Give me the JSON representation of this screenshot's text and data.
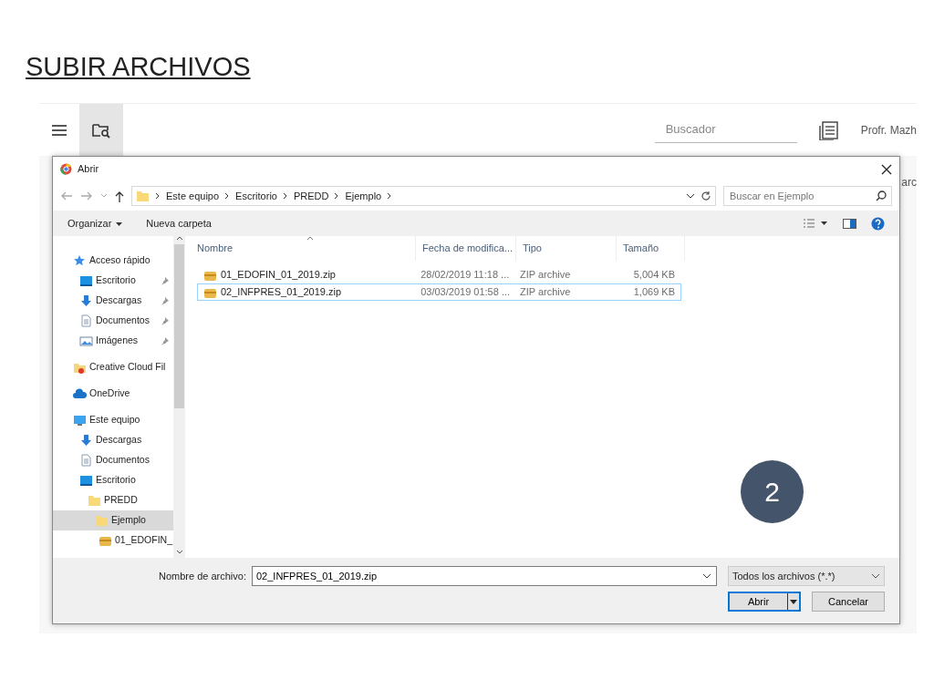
{
  "slide_title": "SUBIR ARCHIVOS",
  "app": {
    "search": {
      "placeholder": "Buscador"
    },
    "user": "Profr. Mazh",
    "edge_text": "arc"
  },
  "dialog": {
    "title": "Abrir",
    "breadcrumb": [
      "Este equipo",
      "Escritorio",
      "PREDD",
      "Ejemplo"
    ],
    "search": {
      "placeholder": "Buscar en Ejemplo"
    },
    "toolbar": [
      {
        "label": "Organizar",
        "dropdown": true
      },
      {
        "label": "Nueva carpeta"
      }
    ],
    "nav": [
      {
        "label": "Acceso rápido",
        "kind": "star",
        "selected": false,
        "children": [
          {
            "label": "Escritorio",
            "kind": "desktop",
            "pinned": true,
            "selected": false
          },
          {
            "label": "Descargas",
            "kind": "download",
            "pinned": true,
            "selected": false
          },
          {
            "label": "Documentos",
            "kind": "document",
            "pinned": true,
            "selected": false
          },
          {
            "label": "Imágenes",
            "kind": "image",
            "pinned": true,
            "selected": false
          }
        ]
      },
      {
        "label": "Creative Cloud Fil",
        "kind": "ccfolder",
        "selected": false
      },
      {
        "label": "OneDrive",
        "kind": "cloud",
        "selected": false
      },
      {
        "label": "Este equipo",
        "kind": "computer",
        "selected": false,
        "children": [
          {
            "label": "Descargas",
            "kind": "download",
            "selected": false
          },
          {
            "label": "Documentos",
            "kind": "document",
            "selected": false
          },
          {
            "label": "Escritorio",
            "kind": "desktop",
            "selected": false,
            "children": [
              {
                "label": "PREDD",
                "kind": "folder",
                "selected": false,
                "children": [
                  {
                    "label": "Ejemplo",
                    "kind": "folder",
                    "selected": true,
                    "children": [
                      {
                        "label": "01_EDOFIN_",
                        "kind": "zip",
                        "selected": false
                      }
                    ]
                  }
                ]
              }
            ]
          }
        ]
      }
    ],
    "columns": [
      {
        "label": "Nombre",
        "sorted": true
      },
      {
        "label": "Fecha de modifica..."
      },
      {
        "label": "Tipo"
      },
      {
        "label": "Tamaño"
      }
    ],
    "files": [
      {
        "name": "01_EDOFIN_01_2019.zip",
        "date": "28/02/2019 11:18 ...",
        "type": "ZIP archive",
        "size": "5,004 KB",
        "selected": false
      },
      {
        "name": "02_INFPRES_01_2019.zip",
        "date": "03/03/2019 01:58 ...",
        "type": "ZIP archive",
        "size": "1,069 KB",
        "selected": true
      }
    ],
    "filename_label": "Nombre de archivo:",
    "filename": "02_INFPRES_01_2019.zip",
    "filter": "Todos los archivos (*.*)",
    "buttons": [
      {
        "label": "Abrir",
        "kind": "split"
      },
      {
        "label": "Cancelar",
        "kind": "plain"
      }
    ]
  },
  "step_badge": "2"
}
